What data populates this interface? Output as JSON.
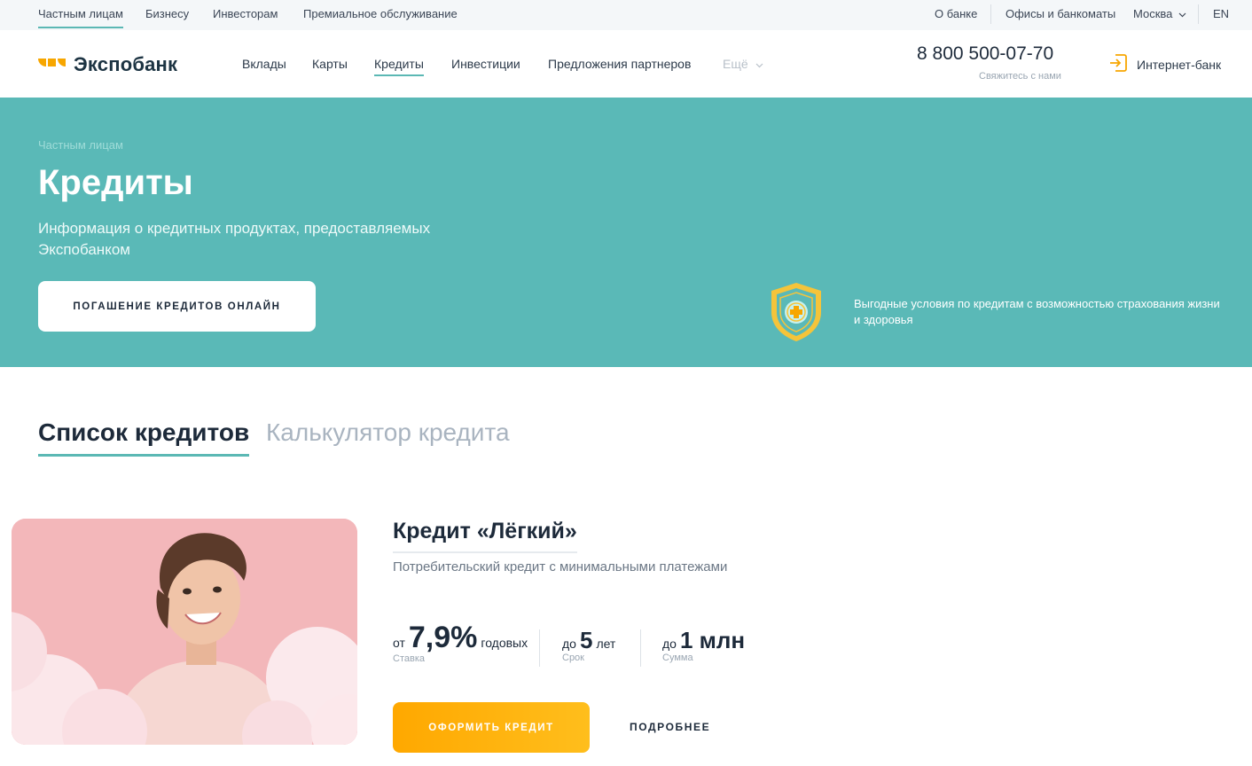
{
  "topbar": {
    "left": [
      "Частным лицам",
      "Бизнесу",
      "Инвесторам",
      "Премиальное обслуживание"
    ],
    "about": "О банке",
    "offices": "Офисы и банкоматы",
    "city": "Москва",
    "lang": "EN"
  },
  "header": {
    "logo_text": "Экспобанк",
    "nav": [
      "Вклады",
      "Карты",
      "Кредиты",
      "Инвестиции",
      "Предложения партнеров"
    ],
    "more": "Ещё",
    "phone": "8 800 500-07-70",
    "phone_sub": "Свяжитесь с нами",
    "internet_bank": "Интернет-банк"
  },
  "hero": {
    "breadcrumb": "Частным лицам",
    "title": "Кредиты",
    "description": "Информация о кредитных продуктах, предоставляемых Экспобанком",
    "button": "ПОГАШЕНИЕ КРЕДИТОВ ОНЛАЙН",
    "promo": "Выгодные условия по кредитам с возможностью страхования жизни и здоровья"
  },
  "tabs": {
    "list": "Список кредитов",
    "calculator": "Калькулятор кредита"
  },
  "card": {
    "title": "Кредит «Лёгкий»",
    "description": "Потребительский кредит с минимальными платежами",
    "rate": {
      "prefix": "от",
      "value": "7,9%",
      "suffix": "годовых",
      "label": "Ставка"
    },
    "term": {
      "prefix": "до",
      "value": "5",
      "suffix": "лет",
      "label": "Срок"
    },
    "amount": {
      "prefix": "до",
      "value": "1 млн",
      "label": "Сумма"
    },
    "apply": "ОФОРМИТЬ КРЕДИТ",
    "more": "ПОДРОБНЕЕ"
  },
  "colors": {
    "accent": "#5ab9b7",
    "button": "#ffa800",
    "dark": "#1d2a3a"
  }
}
